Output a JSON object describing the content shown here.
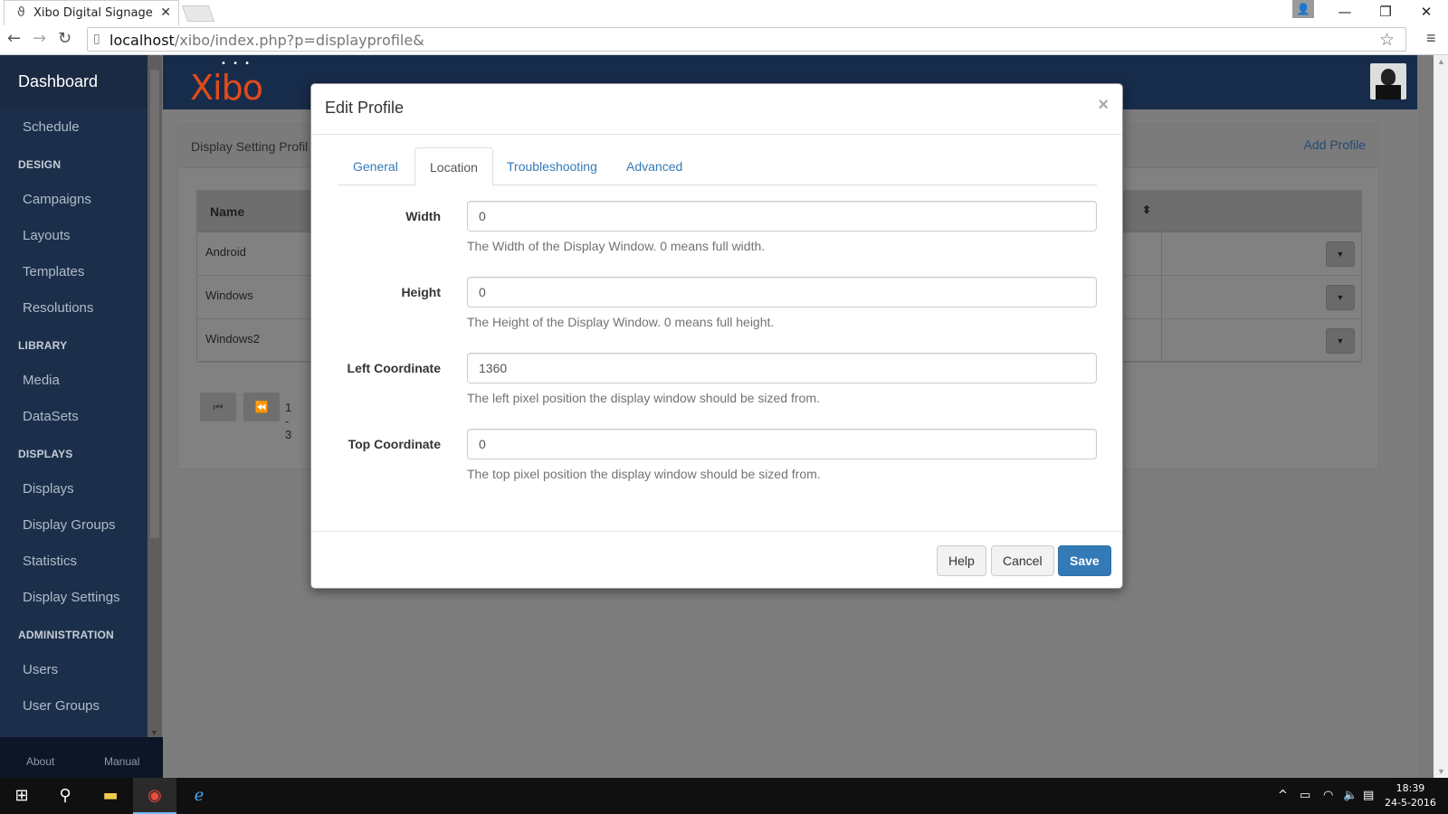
{
  "browser": {
    "tab_title": "Xibo Digital Signage",
    "url_host": "localhost",
    "url_path": "/xibo/index.php?p=displayprofile&"
  },
  "sidebar": {
    "brand": "Dashboard",
    "items": [
      {
        "type": "item",
        "label": "Schedule"
      },
      {
        "type": "head",
        "label": "DESIGN"
      },
      {
        "type": "item",
        "label": "Campaigns"
      },
      {
        "type": "item",
        "label": "Layouts"
      },
      {
        "type": "item",
        "label": "Templates"
      },
      {
        "type": "item",
        "label": "Resolutions"
      },
      {
        "type": "head",
        "label": "LIBRARY"
      },
      {
        "type": "item",
        "label": "Media"
      },
      {
        "type": "item",
        "label": "DataSets"
      },
      {
        "type": "head",
        "label": "DISPLAYS"
      },
      {
        "type": "item",
        "label": "Displays"
      },
      {
        "type": "item",
        "label": "Display Groups"
      },
      {
        "type": "item",
        "label": "Statistics"
      },
      {
        "type": "item",
        "label": "Display Settings"
      },
      {
        "type": "head",
        "label": "ADMINISTRATION"
      },
      {
        "type": "item",
        "label": "Users"
      },
      {
        "type": "item",
        "label": "User Groups"
      }
    ],
    "footer": {
      "about": "About",
      "manual": "Manual"
    }
  },
  "header": {
    "logo": "Xibo"
  },
  "page": {
    "panel_title": "Display Setting Profil",
    "add_profile": "Add Profile",
    "table": {
      "column_name": "Name",
      "rows": [
        "Android",
        "Windows",
        "Windows2"
      ]
    },
    "pager_text": "1 - 3"
  },
  "modal": {
    "title": "Edit Profile",
    "close": "×",
    "tabs": [
      "General",
      "Location",
      "Troubleshooting",
      "Advanced"
    ],
    "active_tab": "Location",
    "fields": [
      {
        "label": "Width",
        "value": "0",
        "help": "The Width of the Display Window. 0 means full width."
      },
      {
        "label": "Height",
        "value": "0",
        "help": "The Height of the Display Window. 0 means full height."
      },
      {
        "label": "Left Coordinate",
        "value": "1360",
        "help": "The left pixel position the display window should be sized from."
      },
      {
        "label": "Top Coordinate",
        "value": "0",
        "help": "The top pixel position the display window should be sized from."
      }
    ],
    "buttons": {
      "help": "Help",
      "cancel": "Cancel",
      "save": "Save"
    }
  },
  "taskbar": {
    "time": "18:39",
    "date": "24-5-2016"
  },
  "colors": {
    "sidebar": "#1c2f4a",
    "topbar": "#172c4b",
    "primary": "#337ab7",
    "logo": "#e04b1a"
  }
}
